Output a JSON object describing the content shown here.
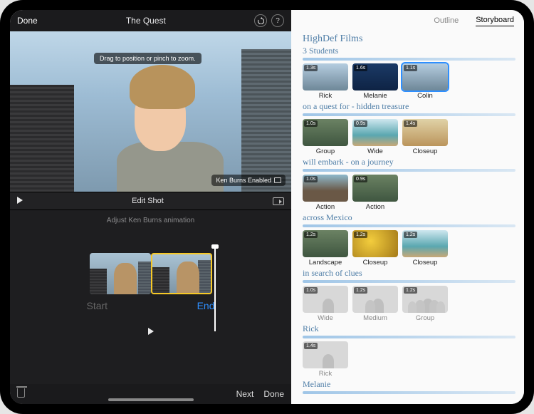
{
  "titlebar": {
    "done": "Done",
    "title": "The Quest",
    "undo_icon": "undo-icon",
    "help_glyph": "?"
  },
  "preview": {
    "hint": "Drag to position or pinch to zoom.",
    "ken_burns_badge": "Ken Burns Enabled"
  },
  "editbar": {
    "title": "Edit Shot"
  },
  "kb": {
    "instruction": "Adjust Ken Burns animation",
    "start_label": "Start",
    "end_label": "End"
  },
  "footer": {
    "next": "Next",
    "done": "Done"
  },
  "tabs": {
    "outline": "Outline",
    "storyboard": "Storyboard"
  },
  "storyboard": {
    "header": "HighDef Films",
    "sections": [
      {
        "subtitle": "3 Students",
        "clips": [
          {
            "label": "Rick",
            "dur": "1.3s",
            "style": "city",
            "selected": false
          },
          {
            "label": "Melanie",
            "dur": "1.6s",
            "style": "navy",
            "selected": false
          },
          {
            "label": "Colin",
            "dur": "1.1s",
            "style": "city",
            "selected": true
          }
        ]
      },
      {
        "subtitle": "on a quest for - hidden treasure",
        "clips": [
          {
            "label": "Group",
            "dur": "1.0s",
            "style": "forest"
          },
          {
            "label": "Wide",
            "dur": "0.9s",
            "style": "beach"
          },
          {
            "label": "Closeup",
            "dur": "1.4s",
            "style": "desert"
          }
        ]
      },
      {
        "subtitle": "will embark - on a journey",
        "clips": [
          {
            "label": "Action",
            "dur": "1.0s",
            "style": "cliff"
          },
          {
            "label": "Action",
            "dur": "0.9s",
            "style": "forest"
          }
        ]
      },
      {
        "subtitle": "across Mexico",
        "clips": [
          {
            "label": "Landscape",
            "dur": "1.2s",
            "style": "forest"
          },
          {
            "label": "Closeup",
            "dur": "1.2s",
            "style": "leaves"
          },
          {
            "label": "Closeup",
            "dur": "1.2s",
            "style": "beach"
          }
        ]
      },
      {
        "subtitle": "in search of clues",
        "clips": [
          {
            "label": "Wide",
            "dur": "1.0s",
            "style": "placeholder",
            "people": 1
          },
          {
            "label": "Medium",
            "dur": "1.2s",
            "style": "placeholder",
            "people": 2
          },
          {
            "label": "Group",
            "dur": "1.2s",
            "style": "placeholder",
            "people": 5
          }
        ]
      },
      {
        "subtitle": "Rick",
        "clips": [
          {
            "label": "Rick",
            "dur": "1.4s",
            "style": "placeholder",
            "people": 1
          }
        ]
      },
      {
        "subtitle": "Melanie",
        "clips": []
      }
    ]
  }
}
